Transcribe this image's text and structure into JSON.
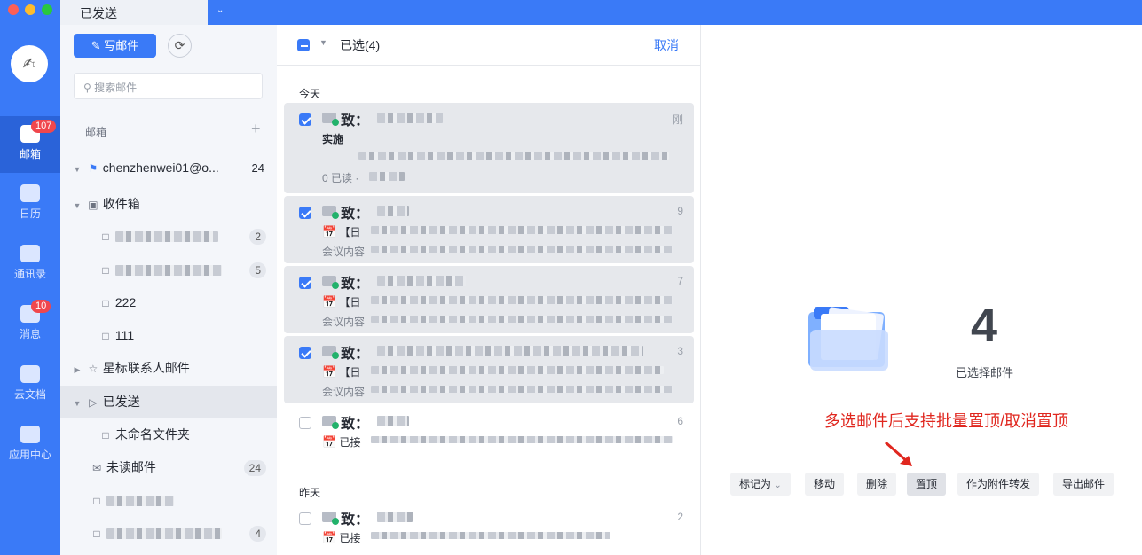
{
  "window": {
    "active_tab": "已发送"
  },
  "rail": {
    "items": [
      {
        "label": "邮箱",
        "badge": "107",
        "active": true
      },
      {
        "label": "日历",
        "badge": ""
      },
      {
        "label": "通讯录",
        "badge": ""
      },
      {
        "label": "消息",
        "badge": "10"
      },
      {
        "label": "云文档",
        "badge": ""
      },
      {
        "label": "应用中心",
        "badge": ""
      }
    ]
  },
  "folders": {
    "compose_label": "写邮件",
    "search_placeholder": "搜索邮件",
    "section_label": "邮箱",
    "account": {
      "name": "chenzhenwei01@o...",
      "count": "24"
    },
    "inbox": {
      "label": "收件箱"
    },
    "sub": [
      {
        "count": "2"
      },
      {
        "count": "5"
      },
      {
        "label": "222"
      },
      {
        "label": "111"
      }
    ],
    "starred": {
      "label": "星标联系人邮件"
    },
    "sent": {
      "label": "已发送"
    },
    "unnamed": {
      "label": "未命名文件夹"
    },
    "unread": {
      "label": "未读邮件",
      "count": "24"
    },
    "extra_count": "4"
  },
  "list": {
    "selected_label": "已选(4)",
    "cancel_label": "取消",
    "today_label": "今天",
    "yesterday_label": "昨天",
    "mails": [
      {
        "to": "致：",
        "line2": "实施",
        "line3": "0 已读 ·",
        "date": "刚",
        "selected": true
      },
      {
        "to": "致：",
        "line2": "【日",
        "line3": "会议内容",
        "date": "9",
        "selected": true
      },
      {
        "to": "致：",
        "line2": "【日",
        "line3": "会议内容",
        "date": "7",
        "selected": true
      },
      {
        "to": "致：",
        "line2": "【日",
        "line3": "会议内容",
        "date": "3",
        "selected": true
      },
      {
        "to": "致：",
        "line2": "已接",
        "line3": "",
        "date": "6",
        "selected": false
      },
      {
        "to": "致：",
        "line2": "已接",
        "line3": "",
        "date": "2",
        "selected": false
      }
    ]
  },
  "preview": {
    "count": "4",
    "count_label": "已选择邮件",
    "annotation": "多选邮件后支持批量置顶/取消置顶",
    "actions": {
      "mark_as": "标记为",
      "move": "移动",
      "delete": "删除",
      "pin": "置顶",
      "forward_as_attachment": "作为附件转发",
      "export": "导出邮件"
    }
  },
  "colors": {
    "accent": "#3a7af7",
    "badge": "#f0474d",
    "annotation": "#e0271f"
  }
}
